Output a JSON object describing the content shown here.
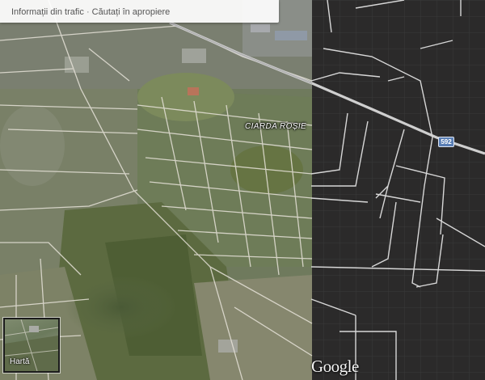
{
  "top_bar": {
    "traffic_link": "Informații din trafic",
    "separator": "·",
    "nearby_link": "Căutați în apropiere"
  },
  "map": {
    "place_label": "CIARDA ROȘIE",
    "route_shield": "592"
  },
  "layer_switcher": {
    "label": "Hartă"
  },
  "branding": {
    "logo": "Google"
  },
  "colors": {
    "dark_map_bg": "#2a2a2a",
    "satellite_base": "#6e7a5a",
    "road_color": "#dcdcdc",
    "route_shield_bg": "#5a7fb5"
  }
}
